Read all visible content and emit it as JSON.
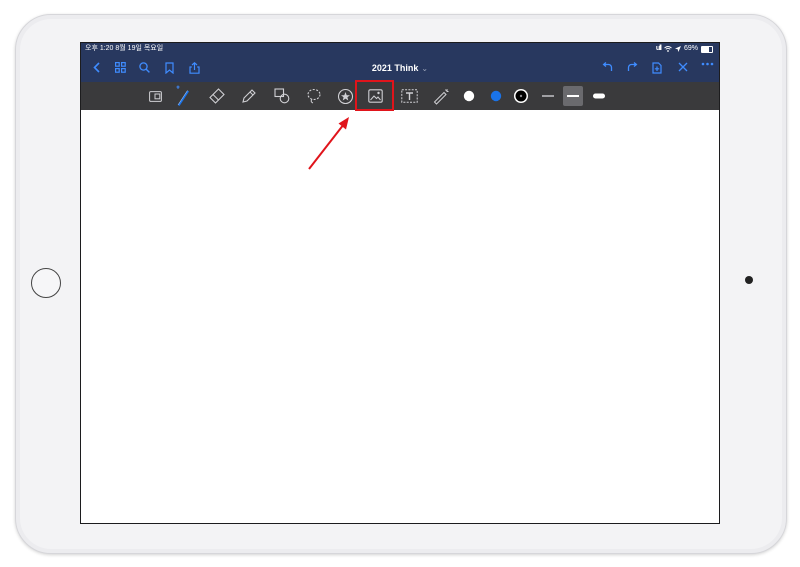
{
  "status_bar": {
    "time_date": "오후 1:20  8월 19일 목요일",
    "signal": "ull",
    "wifi_icon": "wifi-icon",
    "location_icon": "location-arrow-icon",
    "battery_label": "69%",
    "battery_level": 0.69
  },
  "navbar": {
    "title": "2021 Think",
    "title_chevron": "⌄",
    "left_icons": [
      "back-chevron-icon",
      "grid-thumbnails-icon",
      "search-icon",
      "bookmark-icon",
      "share-icon"
    ],
    "right_icons": [
      "undo-icon",
      "redo-icon",
      "add-page-icon",
      "close-icon",
      "more-icon"
    ],
    "accent_color": "#3f8cff"
  },
  "toolbar": {
    "tools": [
      "zoom-window-icon",
      "pen-icon",
      "eraser-icon",
      "highlighter-icon",
      "shapes-icon",
      "lasso-icon",
      "sticker-icon",
      "image-icon",
      "text-box-icon",
      "laser-pointer-icon"
    ],
    "colors": [
      "#ffffff",
      "#1a73e8",
      "#000000"
    ],
    "selected_color": "#000000",
    "stroke_widths": [
      "thin",
      "medium",
      "thick"
    ],
    "selected_stroke": "medium"
  },
  "annotation": {
    "highlight_color": "#e0141b",
    "highlighted_tool": "image-icon"
  }
}
